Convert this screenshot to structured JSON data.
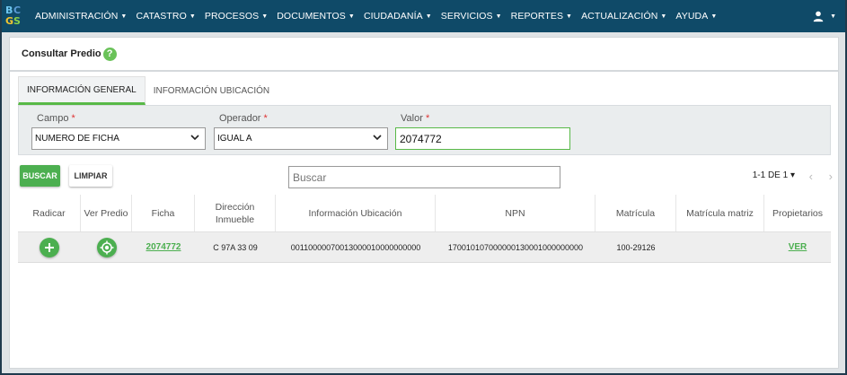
{
  "navbar": {
    "logo": [
      "B",
      "C",
      "G",
      "S"
    ],
    "menu": [
      {
        "label": "ADMINISTRACIÓN"
      },
      {
        "label": "CATASTRO"
      },
      {
        "label": "PROCESOS"
      },
      {
        "label": "DOCUMENTOS"
      },
      {
        "label": "CIUDADANÍA"
      },
      {
        "label": "SERVICIOS"
      },
      {
        "label": "REPORTES"
      },
      {
        "label": "ACTUALIZACIÓN"
      },
      {
        "label": "AYUDA"
      }
    ],
    "caret_glyph": "▼",
    "user_icon": "user-icon",
    "color": "#0f4a68"
  },
  "page": {
    "title": "Consultar Predio",
    "help_glyph": "?"
  },
  "tabs": [
    {
      "label": "INFORMACIÓN GENERAL",
      "active": true
    },
    {
      "label": "INFORMACIÓN UBICACIÓN",
      "active": false
    }
  ],
  "filters": {
    "campo": {
      "label": "Campo",
      "required": "*",
      "value": "NUMERO DE FICHA"
    },
    "operador": {
      "label": "Operador",
      "required": "*",
      "value": "IGUAL A"
    },
    "valor": {
      "label": "Valor",
      "required": "*",
      "value": "2074772"
    }
  },
  "toolbar": {
    "search_label": "BUSCAR",
    "clear_label": "LIMPIAR",
    "search_placeholder": "Buscar",
    "pager_text": "1-1 DE 1",
    "pager_caret": "▾",
    "prev_glyph": "‹",
    "next_glyph": "›"
  },
  "table": {
    "headers": [
      "Radicar",
      "Ver Predio",
      "Ficha",
      "Dirección Inmueble",
      "Información Ubicación",
      "NPN",
      "Matrícula",
      "Matrícula matriz",
      "Propietarios"
    ],
    "rows": [
      {
        "ficha": "2074772",
        "direccion": "C 97A 33 09",
        "info_ubicacion": "00110000070013000010000000000",
        "npn": "170010107000000130001000000000",
        "matricula": "100-29126",
        "matricula_matriz": "",
        "propietarios": "VER"
      }
    ]
  },
  "colors": {
    "accent": "#4caf50",
    "nav": "#0f4a68"
  }
}
